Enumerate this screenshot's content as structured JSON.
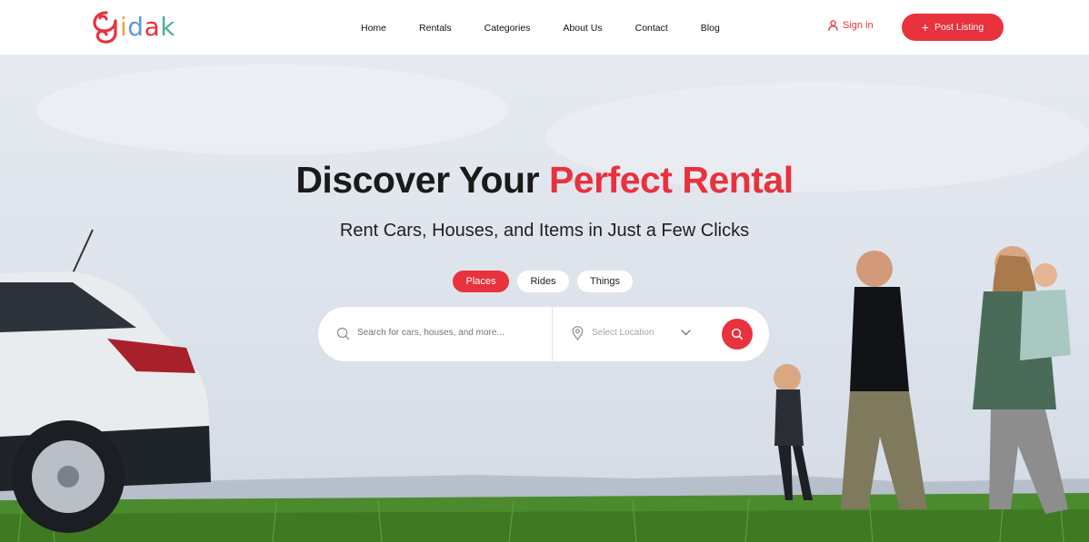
{
  "brand": {
    "logo_text": "idak",
    "logo_letter_colors": [
      "#f0a23b",
      "#5b9bd5",
      "#e8323d",
      "#4caf9a"
    ],
    "accent_color": "#e8323d"
  },
  "nav": {
    "items": [
      "Home",
      "Rentals",
      "Categories",
      "About Us",
      "Contact",
      "Blog"
    ]
  },
  "header": {
    "signin_label": "Sign in",
    "signin_icon": "user-icon",
    "post_label": "Post Listing",
    "post_icon": "plus-icon"
  },
  "hero": {
    "title_main": "Discover Your ",
    "title_accent": "Perfect Rental",
    "subtitle": "Rent Cars, Houses, and Items in Just a Few Clicks",
    "tabs": [
      {
        "label": "Places",
        "active": true
      },
      {
        "label": "Rides",
        "active": false
      },
      {
        "label": "Things",
        "active": false
      }
    ]
  },
  "search": {
    "placeholder": "Search for cars, houses, and more...",
    "location_placeholder": "Select Location",
    "search_icon": "search-icon",
    "location_icon": "map-pin-icon",
    "dropdown_icon": "chevron-down-icon",
    "submit_icon": "search-icon"
  }
}
